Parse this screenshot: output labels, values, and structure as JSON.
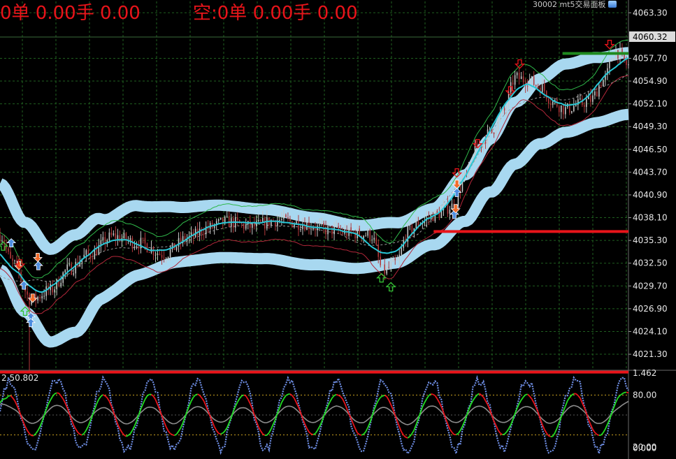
{
  "hud": {
    "long_text": "0单 0.00手 0.00",
    "short_text": "空:0单 0.00手 0.00"
  },
  "panel_title": "30002 mt5交易面板",
  "current_price_tag": "4060.32",
  "oscillator_label": "2 50.802",
  "colors": {
    "background": "#000000",
    "grid": "#1f5f1f",
    "candle_up": "#c8c8c8",
    "candle_down": "#b3393c",
    "band": "#a8d8f0",
    "ma_cyan": "#29c7d6",
    "upper_envelope": "#2fb84a",
    "lower_envelope": "#b3273a",
    "support_line": "#e8141a",
    "resistance_line": "#1f8a1f",
    "osc_blue": "#6f8fe6",
    "osc_green": "#22dd22",
    "osc_red": "#e8141a",
    "osc_grey": "#8c8c8c",
    "arrow_buy": "#35c236",
    "arrow_sell": "#e8141a",
    "arrow_blue": "#4f8fe0",
    "arrow_orange": "#f06a2a"
  },
  "chart_data": [
    {
      "type": "candlestick",
      "y_axis": {
        "ticks": [
          "4063.30",
          "4057.70",
          "4054.90",
          "4052.10",
          "4049.30",
          "4046.50",
          "4043.70",
          "4040.90",
          "4038.10",
          "4035.30",
          "4032.50",
          "4029.70",
          "4026.90",
          "4024.10",
          "4021.30"
        ],
        "range": [
          4019.5,
          4064.7
        ]
      },
      "current_price": 4060.32,
      "horizontal_levels": [
        {
          "name": "support",
          "price": 4036.4,
          "from_index": 0.69,
          "color": "#e8141a"
        },
        {
          "name": "floor",
          "price": 4019.1,
          "from_index": 0.0,
          "color": "#e8141a"
        },
        {
          "name": "resistance",
          "price": 4058.3,
          "from_index": 0.895,
          "color": "#1f8a1f"
        }
      ],
      "price_path_keypoints": [
        [
          0.0,
          4036.0
        ],
        [
          0.02,
          4032.5
        ],
        [
          0.05,
          4028.0
        ],
        [
          0.08,
          4029.2
        ],
        [
          0.11,
          4031.8
        ],
        [
          0.14,
          4033.5
        ],
        [
          0.18,
          4035.8
        ],
        [
          0.22,
          4035.0
        ],
        [
          0.26,
          4033.6
        ],
        [
          0.3,
          4035.6
        ],
        [
          0.33,
          4036.8
        ],
        [
          0.36,
          4037.6
        ],
        [
          0.4,
          4037.0
        ],
        [
          0.44,
          4037.8
        ],
        [
          0.48,
          4037.4
        ],
        [
          0.52,
          4036.6
        ],
        [
          0.56,
          4036.2
        ],
        [
          0.59,
          4036.0
        ],
        [
          0.61,
          4031.5
        ],
        [
          0.63,
          4032.5
        ],
        [
          0.65,
          4036.4
        ],
        [
          0.67,
          4037.6
        ],
        [
          0.69,
          4038.4
        ],
        [
          0.72,
          4039.5
        ],
        [
          0.74,
          4043.0
        ],
        [
          0.76,
          4046.8
        ],
        [
          0.78,
          4048.5
        ],
        [
          0.8,
          4051.0
        ],
        [
          0.82,
          4055.3
        ],
        [
          0.84,
          4055.0
        ],
        [
          0.86,
          4054.2
        ],
        [
          0.88,
          4052.3
        ],
        [
          0.9,
          4051.4
        ],
        [
          0.92,
          4052.0
        ],
        [
          0.94,
          4052.6
        ],
        [
          0.96,
          4055.0
        ],
        [
          0.98,
          4058.6
        ],
        [
          1.0,
          4056.8
        ]
      ],
      "band_mid_keypoints": [
        [
          0.0,
          4037.0
        ],
        [
          0.04,
          4032.0
        ],
        [
          0.08,
          4028.5
        ],
        [
          0.12,
          4030.0
        ],
        [
          0.16,
          4033.0
        ],
        [
          0.22,
          4035.3
        ],
        [
          0.28,
          4036.0
        ],
        [
          0.35,
          4036.4
        ],
        [
          0.42,
          4036.1
        ],
        [
          0.5,
          4035.2
        ],
        [
          0.57,
          4034.5
        ],
        [
          0.63,
          4035.0
        ],
        [
          0.69,
          4037.0
        ],
        [
          0.74,
          4040.5
        ],
        [
          0.78,
          4044.5
        ],
        [
          0.82,
          4048.5
        ],
        [
          0.86,
          4051.2
        ],
        [
          0.9,
          4052.8
        ],
        [
          0.95,
          4053.8
        ],
        [
          1.0,
          4054.6
        ]
      ],
      "band_halfwidth_keypoints": [
        [
          0.0,
          5.3
        ],
        [
          0.08,
          5.7
        ],
        [
          0.12,
          6.0
        ],
        [
          0.18,
          4.6
        ],
        [
          0.3,
          3.3
        ],
        [
          0.45,
          3.0
        ],
        [
          0.6,
          2.6
        ],
        [
          0.68,
          2.2
        ],
        [
          0.75,
          2.9
        ],
        [
          0.82,
          3.8
        ],
        [
          0.9,
          4.2
        ],
        [
          1.0,
          3.8
        ]
      ],
      "signal_arrows": [
        {
          "index": 0.005,
          "price": 4034.6,
          "dir": "up",
          "color": "buy"
        },
        {
          "index": 0.018,
          "price": 4035.0,
          "dir": "up",
          "color": "blue"
        },
        {
          "index": 0.03,
          "price": 4032.2,
          "dir": "down",
          "color": "orange"
        },
        {
          "index": 0.032,
          "price": 4032.4,
          "dir": "down",
          "color": "sell"
        },
        {
          "index": 0.038,
          "price": 4029.8,
          "dir": "up",
          "color": "blue"
        },
        {
          "index": 0.04,
          "price": 4026.6,
          "dir": "up",
          "color": "buy"
        },
        {
          "index": 0.049,
          "price": 4025.9,
          "dir": "up",
          "color": "blue"
        },
        {
          "index": 0.049,
          "price": 4025.2,
          "dir": "up",
          "color": "blue"
        },
        {
          "index": 0.052,
          "price": 4028.2,
          "dir": "down",
          "color": "orange"
        },
        {
          "index": 0.06,
          "price": 4033.2,
          "dir": "down",
          "color": "orange"
        },
        {
          "index": 0.061,
          "price": 4032.2,
          "dir": "up",
          "color": "blue"
        },
        {
          "index": 0.607,
          "price": 4030.7,
          "dir": "up",
          "color": "buy"
        },
        {
          "index": 0.622,
          "price": 4029.6,
          "dir": "up",
          "color": "buy"
        },
        {
          "index": 0.727,
          "price": 4041.2,
          "dir": "up",
          "color": "blue"
        },
        {
          "index": 0.727,
          "price": 4043.6,
          "dir": "down",
          "color": "sell"
        },
        {
          "index": 0.727,
          "price": 4042.2,
          "dir": "down",
          "color": "orange"
        },
        {
          "index": 0.723,
          "price": 4038.5,
          "dir": "up",
          "color": "blue"
        },
        {
          "index": 0.725,
          "price": 4039.2,
          "dir": "down",
          "color": "orange"
        },
        {
          "index": 0.76,
          "price": 4047.2,
          "dir": "down",
          "color": "sell"
        },
        {
          "index": 0.812,
          "price": 4053.7,
          "dir": "down",
          "color": "sell"
        },
        {
          "index": 0.827,
          "price": 4057.0,
          "dir": "down",
          "color": "sell"
        },
        {
          "index": 0.97,
          "price": 4059.4,
          "dir": "down",
          "color": "sell"
        }
      ]
    },
    {
      "type": "line",
      "name": "oscillator",
      "y_axis": {
        "ticks": [
          "1.462",
          "80.00",
          "0.000",
          "20.00"
        ]
      },
      "shown_value": 50.802,
      "levels": [
        80,
        20
      ]
    }
  ]
}
